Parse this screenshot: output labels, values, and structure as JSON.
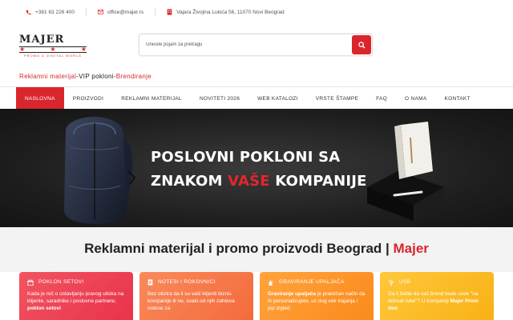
{
  "topbar": {
    "phone": "+381 63 226 400",
    "email": "office@majer.rs",
    "address": "Vajara Živojina Lukića 56, 11070 Novi Beograd"
  },
  "logo": {
    "wordmark": "MAJER",
    "tagline": "PROMO & DIGITAL WORLD"
  },
  "search": {
    "placeholder": "Unesite pojam za pretragu"
  },
  "subline": {
    "part1": "Reklamni materijal",
    "sep1": " - ",
    "part2": "VIP pokloni",
    "sep2": " - ",
    "part3": "Brendiranje"
  },
  "nav": {
    "items": [
      {
        "label": "NASLOVNA"
      },
      {
        "label": "PROIZVODI"
      },
      {
        "label": "REKLAMNI MATERIJAL"
      },
      {
        "label": "NOVITETI 2026"
      },
      {
        "label": "WEB KATALOZI"
      },
      {
        "label": "VRSTE ŠTAMPE"
      },
      {
        "label": "FAQ"
      },
      {
        "label": "O NAMA"
      },
      {
        "label": "KONTAKT"
      }
    ]
  },
  "banner": {
    "line1": "POSLOVNI POKLONI SA",
    "line2_pre": "ZNAKOM ",
    "line2_hl": "VAŠE",
    "line2_post": " KOMPANIJE"
  },
  "section": {
    "title": "Reklamni materijal i promo proizvodi Beograd | ",
    "title_brand": "Majer"
  },
  "cards": [
    {
      "title": "POKLON SETOVI",
      "text_pre": "Kada je reč o ostavljanju pravog utiska na klijente, saradnike i poslovne partnere, ",
      "text_bold": "poklon setovi",
      "text_post": ""
    },
    {
      "title": "NOTESI I ROKOVNICI",
      "text_pre": "Bez obzira da li su vaši klijenti biznis kompanije ili ne, svaki od njih zahteva notese za",
      "text_bold": "",
      "text_post": ""
    },
    {
      "title": "GRAVIRANJE UPALJAČA",
      "text_pre": "",
      "text_bold": "Graviranje upaljača",
      "text_post": " je praktičan način da ih personalizujete, uz dug vek trajanja i jep izgled."
    },
    {
      "title": "USB",
      "text_pre": "Da li želite da vaš brend bude uvek \"na dohvat ruke\"? U kompaniji ",
      "text_bold": "Majer Prom doo",
      "text_post": ""
    }
  ],
  "colors": {
    "accent": "#d9262c"
  }
}
